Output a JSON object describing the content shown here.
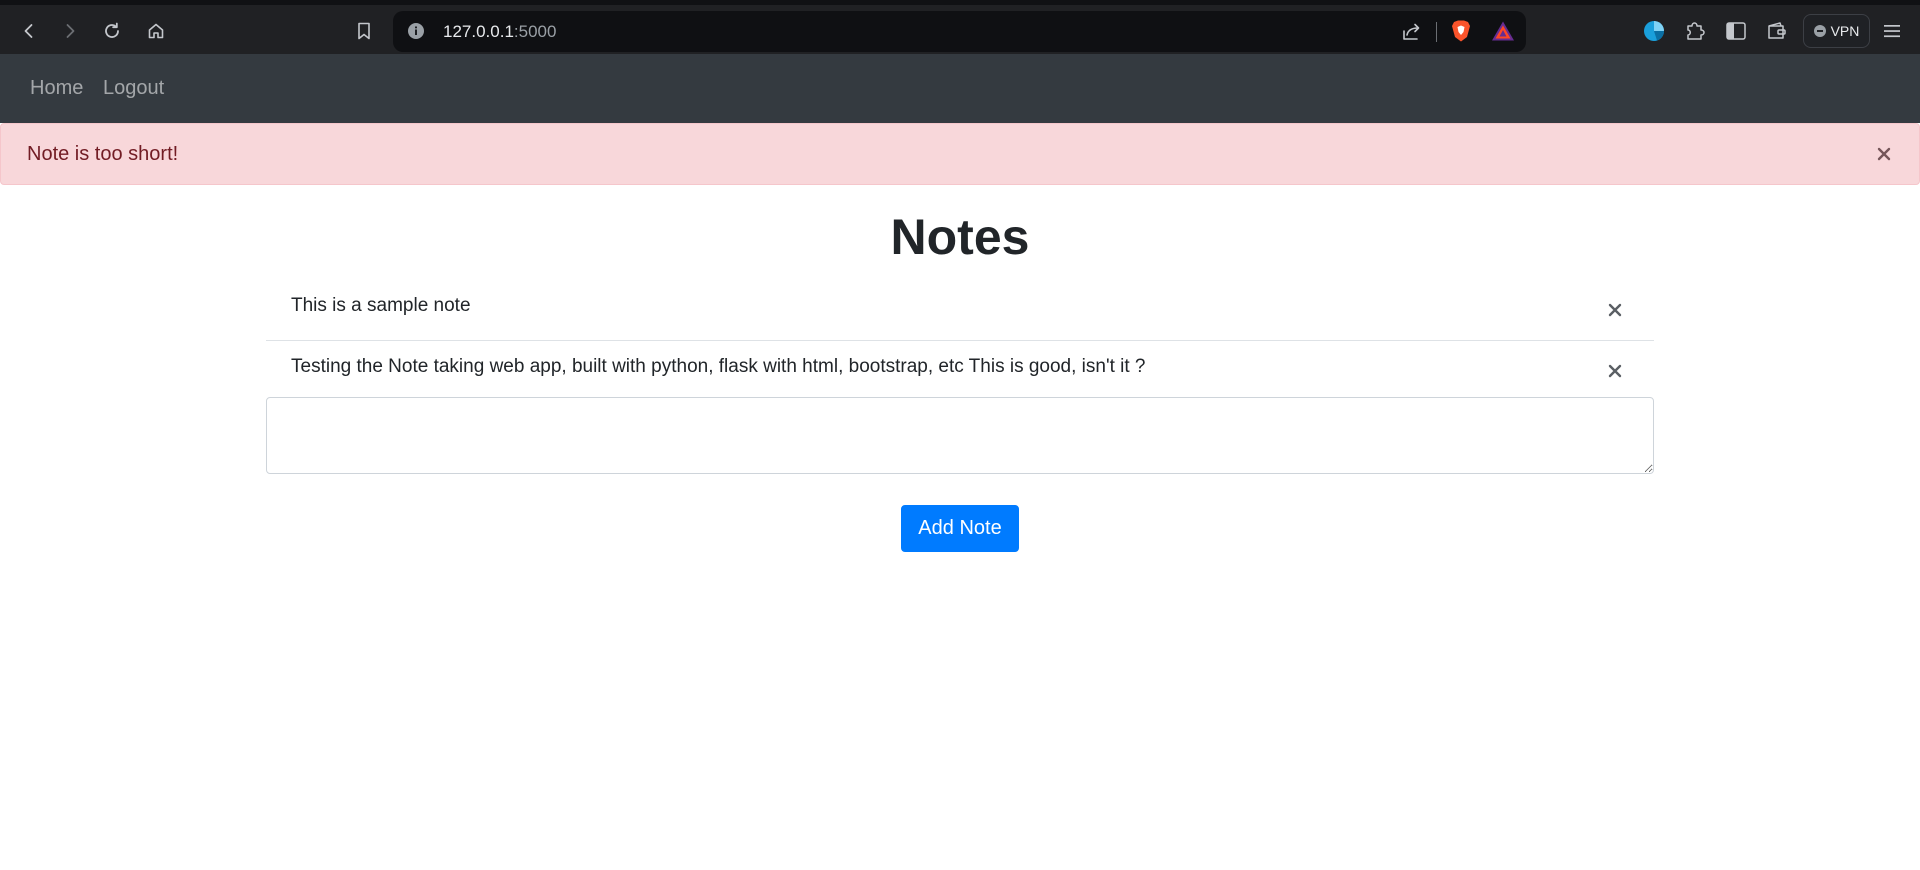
{
  "browser": {
    "url_host": "127.0.0.1",
    "url_port": ":5000",
    "vpn_label": "VPN"
  },
  "nav": {
    "home": "Home",
    "logout": "Logout"
  },
  "alert": {
    "message": "Note is too short!",
    "type": "danger",
    "color": "#f8d7da"
  },
  "page": {
    "title": "Notes"
  },
  "notes": [
    {
      "text": "This is a sample note"
    },
    {
      "text": "Testing the Note taking web app, built with python, flask with html, bootstrap, etc This is good, isn't it ?"
    }
  ],
  "form": {
    "textarea_value": "",
    "submit_label": "Add Note",
    "submit_color": "#007bff"
  },
  "icons": {
    "back": "arrow-left-icon",
    "forward": "arrow-right-icon",
    "reload": "reload-icon",
    "home": "home-icon",
    "bookmark": "bookmark-icon",
    "site_info": "info-icon",
    "share": "share-icon",
    "brave": "brave-shield-icon",
    "rewards": "rewards-triangle-icon",
    "extension_pie": "pie-extension-icon",
    "extensions": "puzzle-icon",
    "sidebar": "sidebar-icon",
    "wallet": "wallet-icon",
    "menu": "hamburger-menu-icon",
    "close": "close-icon"
  }
}
